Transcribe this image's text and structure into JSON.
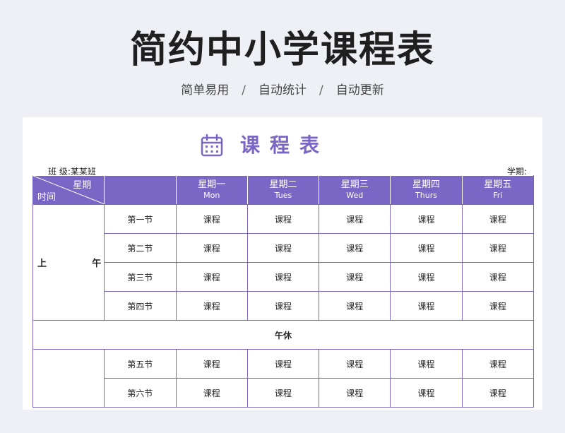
{
  "title": "简约中小学课程表",
  "subtitle": [
    "简单易用",
    "自动统计",
    "自动更新"
  ],
  "subtitle_separator": "/",
  "sheet": {
    "heading": "课程表",
    "class_label": "班 级:某某班",
    "term_label": "学期:",
    "header": {
      "week_label": "星期",
      "time_label": "时间",
      "days": [
        {
          "cn": "星期一",
          "en": "Mon"
        },
        {
          "cn": "星期二",
          "en": "Tues"
        },
        {
          "cn": "星期三",
          "en": "Wed"
        },
        {
          "cn": "星期四",
          "en": "Thurs"
        },
        {
          "cn": "星期五",
          "en": "Fri"
        }
      ]
    },
    "morning": {
      "label_left": "上",
      "label_right": "午",
      "periods": [
        "第一节",
        "第二节",
        "第三节",
        "第四节"
      ]
    },
    "noon_break": "午休",
    "afternoon": {
      "periods": [
        "第五节",
        "第六节"
      ]
    },
    "cell_text": "课程"
  },
  "colors": {
    "accent": "#7a66c4",
    "background": "#eef0f5"
  },
  "icons": {
    "heading_icon": "calendar-icon"
  }
}
